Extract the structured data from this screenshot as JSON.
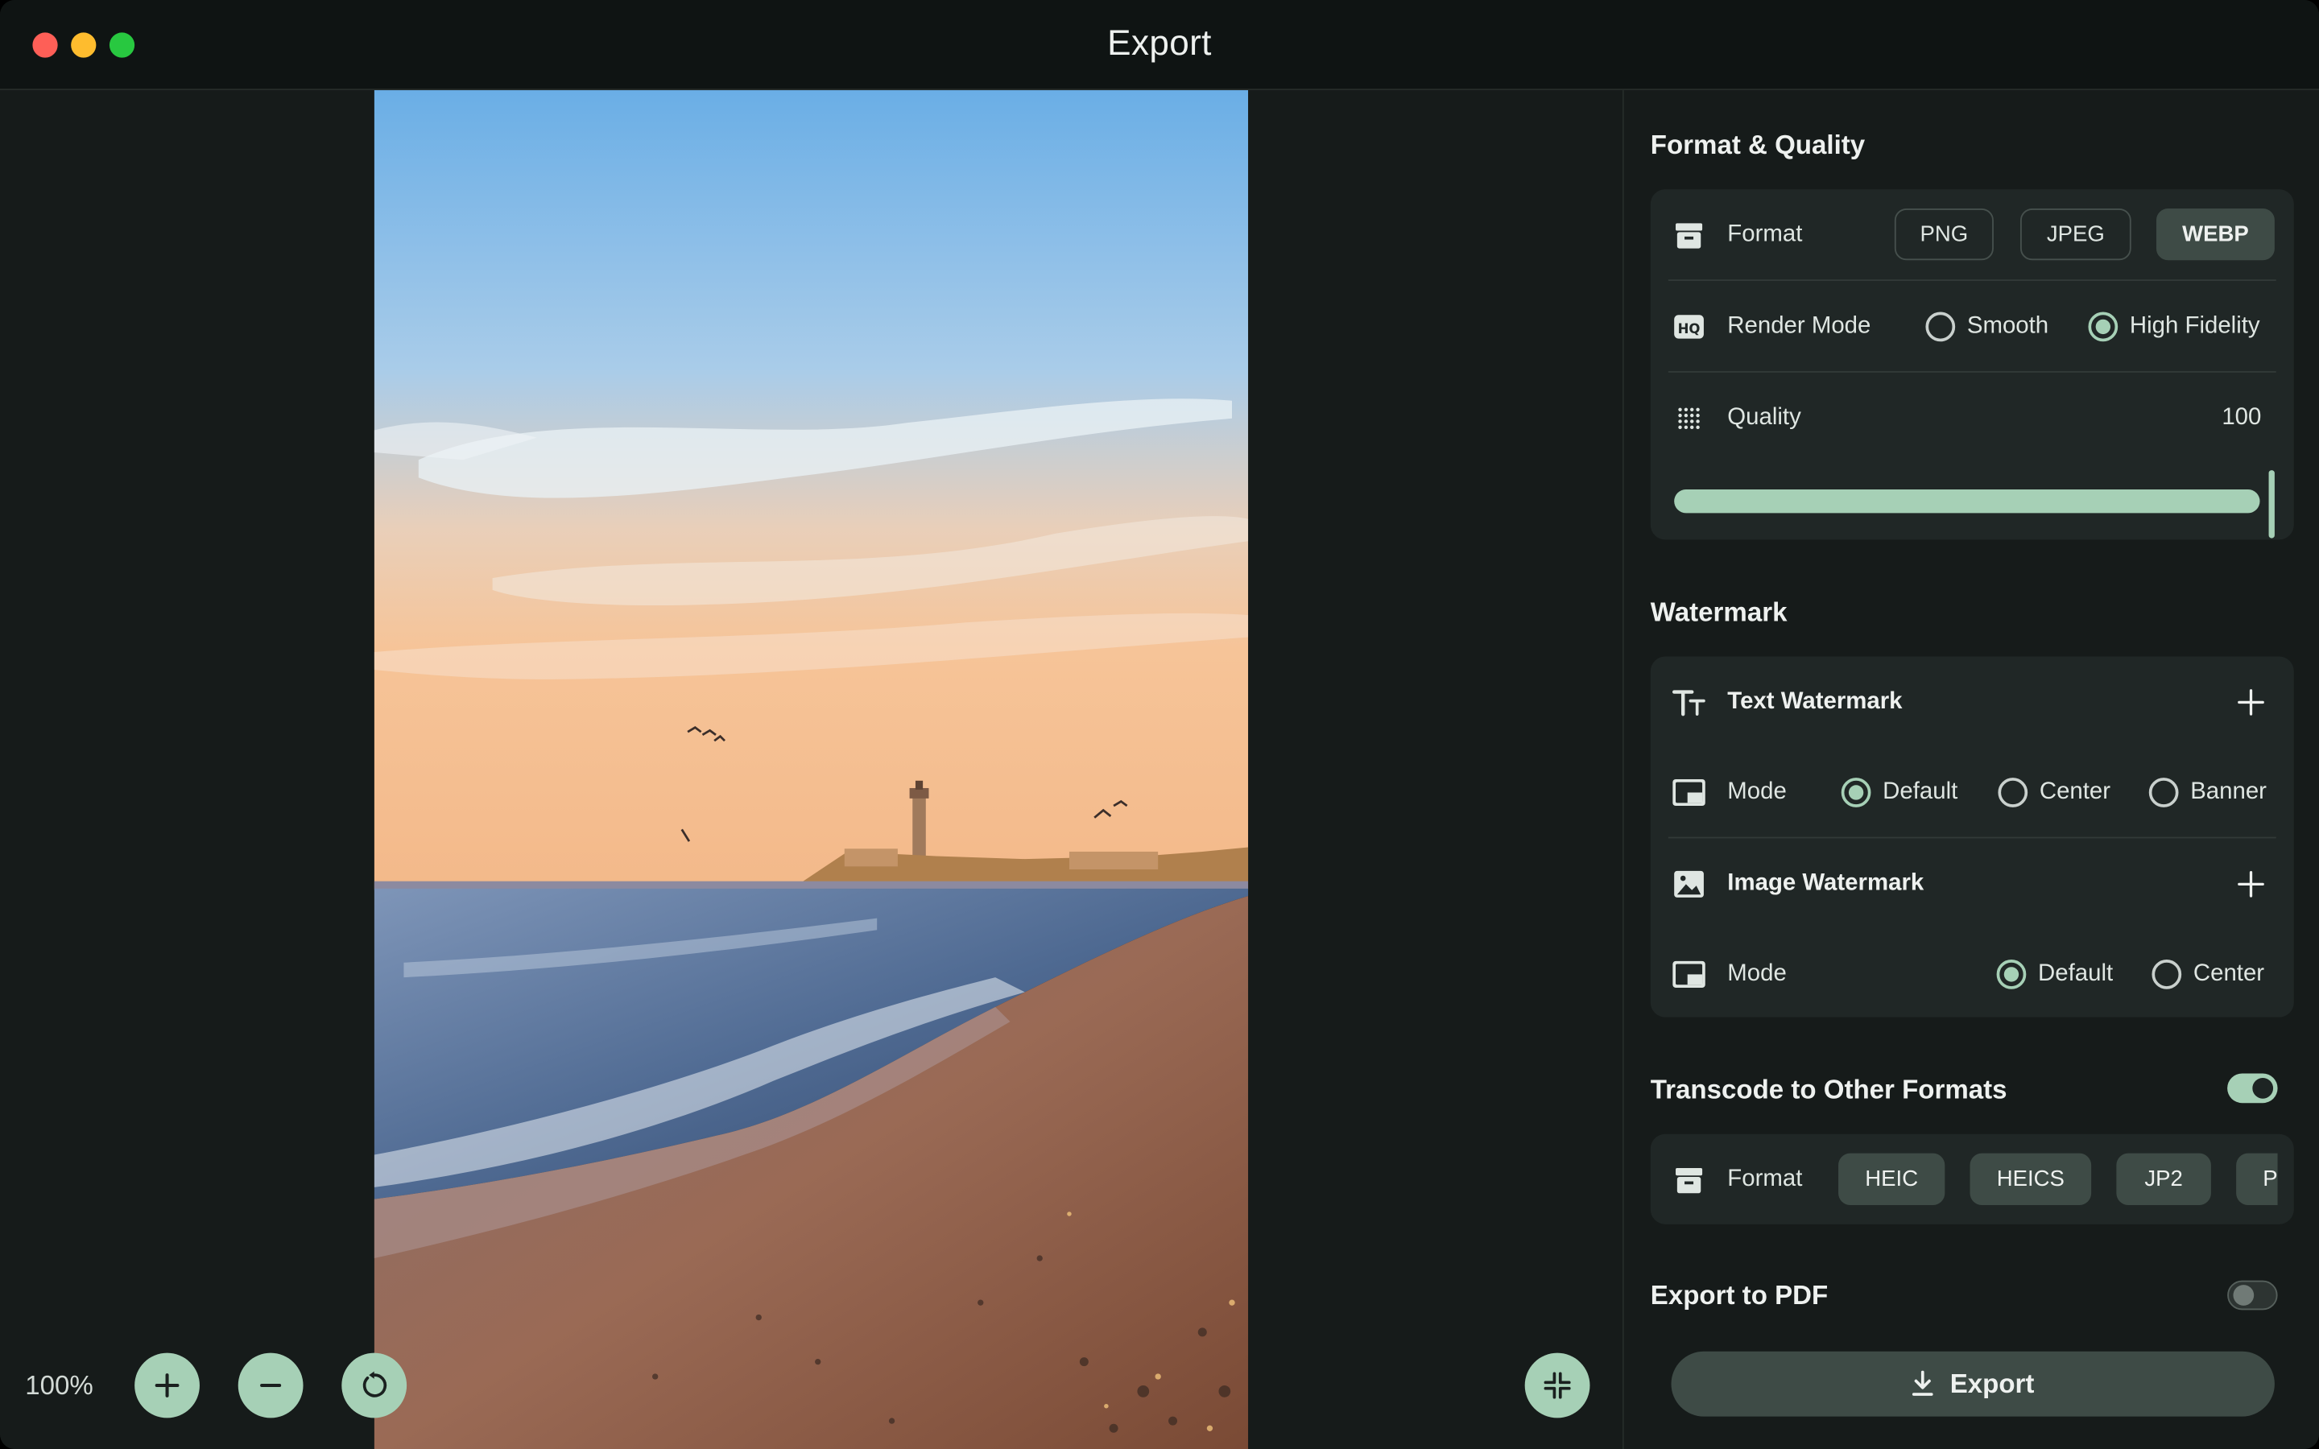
{
  "window": {
    "title": "Export"
  },
  "preview": {
    "zoom": "100%",
    "photo_description_icon": "lighthouse-beach-photo"
  },
  "format_quality": {
    "title": "Format & Quality",
    "format": {
      "label": "Format",
      "options": [
        "PNG",
        "JPEG",
        "WEBP"
      ],
      "selected": "WEBP"
    },
    "render_mode": {
      "label": "Render Mode",
      "options": [
        "Smooth",
        "High Fidelity"
      ],
      "selected": "High Fidelity"
    },
    "quality": {
      "label": "Quality",
      "value": "100",
      "fraction": 1.0
    }
  },
  "watermark": {
    "title": "Watermark",
    "text_watermark": {
      "label": "Text Watermark",
      "mode_label": "Mode",
      "modes": [
        "Default",
        "Center",
        "Banner"
      ],
      "selected": "Default"
    },
    "image_watermark": {
      "label": "Image Watermark",
      "mode_label": "Mode",
      "modes": [
        "Default",
        "Center"
      ],
      "selected": "Default"
    }
  },
  "transcode": {
    "title": "Transcode to Other Formats",
    "enabled": true,
    "format_label": "Format",
    "formats": [
      "HEIC",
      "HEICS",
      "JP2",
      "P"
    ]
  },
  "export_pdf": {
    "title": "Export to PDF",
    "enabled": false
  },
  "export_button": {
    "label": "Export"
  },
  "colors": {
    "accent": "#a6d0b6",
    "panel": "#202726",
    "background": "#161b1a",
    "button": "#3e4b46"
  }
}
